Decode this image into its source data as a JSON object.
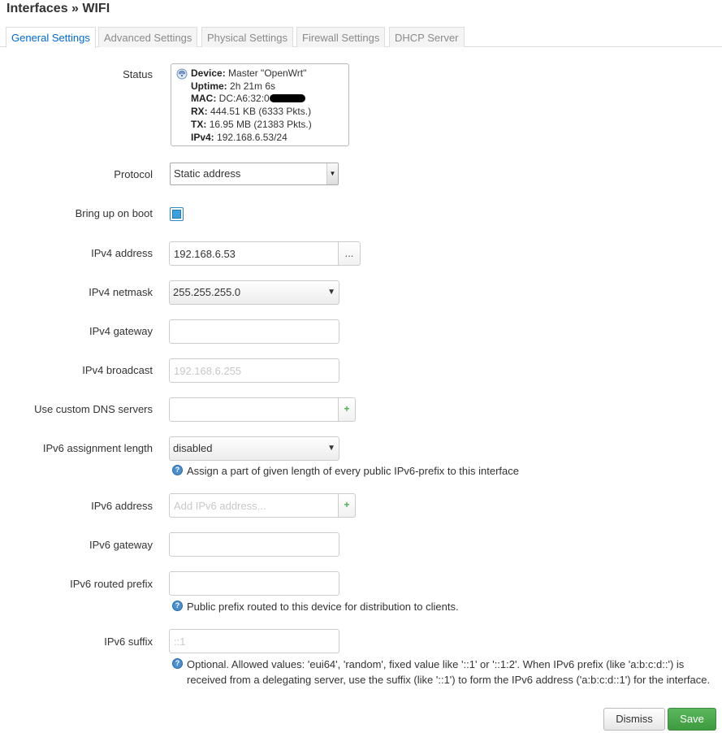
{
  "page": {
    "title": "Interfaces » WIFI"
  },
  "tabs": [
    {
      "label": "General Settings",
      "active": true
    },
    {
      "label": "Advanced Settings"
    },
    {
      "label": "Physical Settings"
    },
    {
      "label": "Firewall Settings"
    },
    {
      "label": "DHCP Server"
    }
  ],
  "status": {
    "label": "Status",
    "device_key": "Device:",
    "device_val": "Master \"OpenWrt\"",
    "uptime_key": "Uptime:",
    "uptime_val": "2h 21m 6s",
    "mac_key": "MAC:",
    "mac_val": "DC:A6:32:0",
    "rx_key": "RX:",
    "rx_val": "444.51 KB (6333 Pkts.)",
    "tx_key": "TX:",
    "tx_val": "16.95 MB (21383 Pkts.)",
    "ipv4_key": "IPv4:",
    "ipv4_val": "192.168.6.53/24"
  },
  "protocol": {
    "label": "Protocol",
    "value": "Static address"
  },
  "boot": {
    "label": "Bring up on boot",
    "checked": true
  },
  "ipv4_address": {
    "label": "IPv4 address",
    "value": "192.168.6.53",
    "button": "..."
  },
  "ipv4_netmask": {
    "label": "IPv4 netmask",
    "value": "255.255.255.0"
  },
  "ipv4_gateway": {
    "label": "IPv4 gateway",
    "value": ""
  },
  "ipv4_broadcast": {
    "label": "IPv4 broadcast",
    "placeholder": "192.168.6.255"
  },
  "dns": {
    "label": "Use custom DNS servers",
    "value": "",
    "button": "+"
  },
  "ipv6_assign": {
    "label": "IPv6 assignment length",
    "value": "disabled",
    "help": "Assign a part of given length of every public IPv6-prefix to this interface"
  },
  "ipv6_address": {
    "label": "IPv6 address",
    "placeholder": "Add IPv6 address...",
    "button": "+"
  },
  "ipv6_gateway": {
    "label": "IPv6 gateway",
    "value": ""
  },
  "ipv6_prefix": {
    "label": "IPv6 routed prefix",
    "value": "",
    "help": "Public prefix routed to this device for distribution to clients."
  },
  "ipv6_suffix": {
    "label": "IPv6 suffix",
    "placeholder": "::1",
    "help_line1": "Optional. Allowed values: 'eui64', 'random', fixed value like '::1' or '::1:2'. When IPv6 prefix (like 'a:b:c:d::') is",
    "help_line2": "received from a delegating server, use the suffix (like '::1') to form the IPv6 address ('a:b:c:d::1') for the interface."
  },
  "actions": {
    "dismiss": "Dismiss",
    "save": "Save"
  },
  "colors": {
    "accent": "#0069d6",
    "save": "#4cae4c",
    "help": "#4a90d0"
  }
}
